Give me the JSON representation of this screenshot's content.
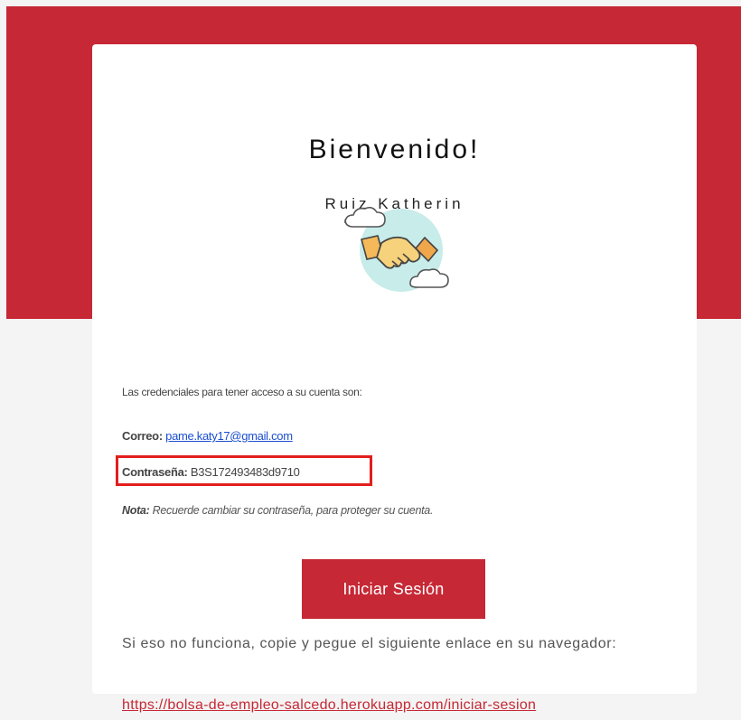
{
  "colors": {
    "brand_red": "#c62835",
    "background": "#f4f4f4",
    "card": "#ffffff",
    "link_blue": "#1a4ed0",
    "highlight": "#e21d1d"
  },
  "email": {
    "title": "Bienvenido!",
    "recipient_name": "Ruiz Katherin",
    "illustration": "handshake-icon",
    "intro": "Las credenciales para tener acceso a su cuenta son:",
    "correo_label": "Correo:",
    "correo_value": "pame.katy17@gmail.com",
    "password_label": "Contraseña:",
    "password_value": "B3S172493483d9710",
    "note_label": "Nota:",
    "note_text": "Recuerde cambiar su contraseña, para proteger su cuenta.",
    "cta_label": "Iniciar Sesión",
    "fallback_text": "Si eso no funciona, copie y pegue el siguiente enlace en su navegador:",
    "fallback_link": "https://bolsa-de-empleo-salcedo.herokuapp.com/iniciar-sesion"
  }
}
